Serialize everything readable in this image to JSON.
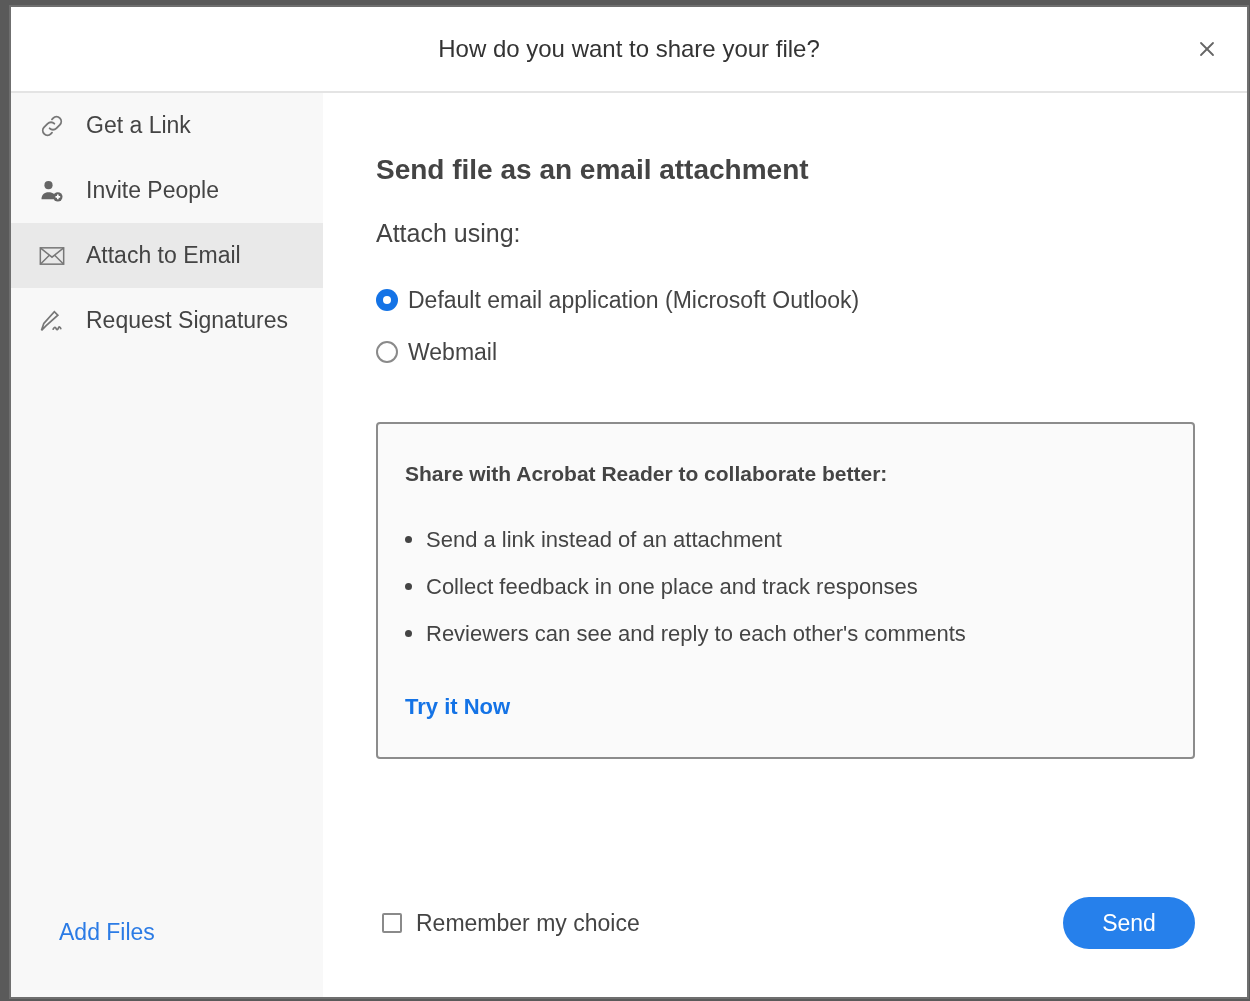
{
  "dialog": {
    "title": "How do you want to share your file?"
  },
  "sidebar": {
    "items": [
      {
        "label": "Get a Link",
        "selected": false
      },
      {
        "label": "Invite People",
        "selected": false
      },
      {
        "label": "Attach to Email",
        "selected": true
      },
      {
        "label": "Request Signatures",
        "selected": false
      }
    ],
    "footer_link": "Add Files"
  },
  "main": {
    "heading": "Send file as an email attachment",
    "subheading": "Attach using:",
    "options": [
      {
        "label": "Default email application (Microsoft Outlook)",
        "selected": true
      },
      {
        "label": "Webmail",
        "selected": false
      }
    ],
    "promo": {
      "title": "Share with Acrobat Reader to collaborate better:",
      "bullets": [
        "Send a link instead of an attachment",
        "Collect feedback in one place and track responses",
        "Reviewers can see and reply to each other's comments"
      ],
      "link": "Try it Now"
    },
    "remember": {
      "label": "Remember my choice",
      "checked": false
    },
    "send_button": "Send"
  }
}
